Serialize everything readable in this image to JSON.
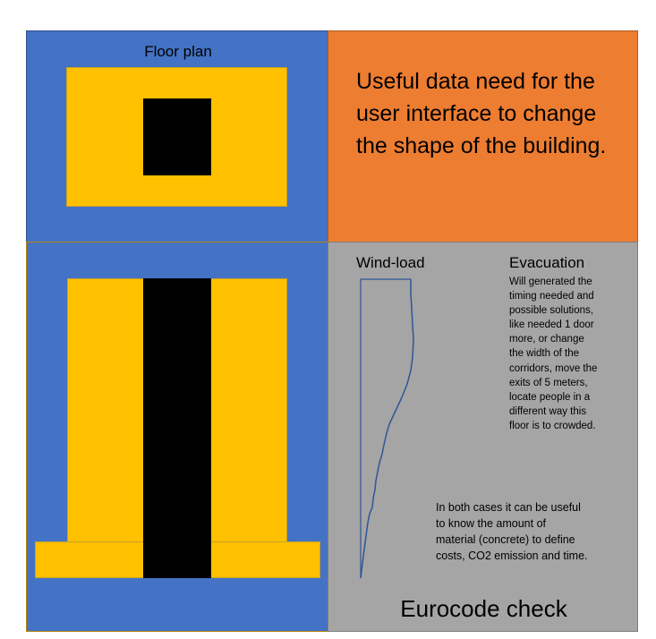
{
  "floor_plan": {
    "title": "Floor plan",
    "colors": {
      "background": "#4472c4",
      "slab": "#ffc000",
      "core": "#000000"
    }
  },
  "data_note": {
    "text": "Useful data need for the user interface to change the shape of the building.",
    "color": "#ed7d31"
  },
  "elevation": {
    "colors": {
      "background": "#4472c4",
      "building": "#ffc000",
      "core": "#000000"
    }
  },
  "eurocode": {
    "wind_title": "Wind-load",
    "evacuation_title": "Evacuation",
    "evacuation_text": "Will generated the timing needed and possible solutions, like needed 1 door more, or change the width of the corridors, move the exits of 5 meters, locate people in a different way this floor is to crowded.",
    "both_cases_text": "In both cases it can be useful to know the amount of material (concrete) to define costs, CO2 emission and time.",
    "title": "Eurocode check",
    "background": "#a5a5a5",
    "wind_line_color": "#2f5597"
  }
}
